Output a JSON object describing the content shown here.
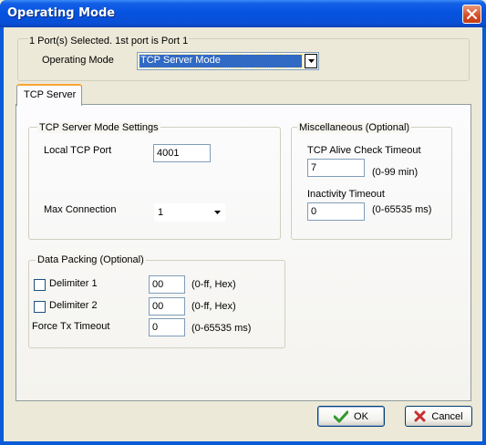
{
  "window": {
    "title": "Operating Mode"
  },
  "header": {
    "ports_info": "1 Port(s) Selected. 1st port is Port 1",
    "operating_mode_label": "Operating Mode",
    "operating_mode_value": "TCP Server Mode"
  },
  "tabs": [
    {
      "label": "TCP Server",
      "active": true
    }
  ],
  "tcp_server_settings": {
    "title": "TCP Server Mode Settings",
    "local_tcp_port_label": "Local TCP Port",
    "local_tcp_port_value": "4001",
    "max_connection_label": "Max Connection",
    "max_connection_value": "1"
  },
  "miscellaneous": {
    "title": "Miscellaneous (Optional)",
    "alive_check_label": "TCP Alive Check Timeout",
    "alive_check_value": "7",
    "alive_check_hint": "(0-99 min)",
    "inactivity_label": "Inactivity Timeout",
    "inactivity_value": "0",
    "inactivity_hint": "(0-65535 ms)"
  },
  "data_packing": {
    "title": "Data Packing (Optional)",
    "delimiter1_label": "Delimiter 1",
    "delimiter1_value": "00",
    "delimiter1_hint": "(0-ff, Hex)",
    "delimiter1_checked": false,
    "delimiter2_label": "Delimiter 2",
    "delimiter2_value": "00",
    "delimiter2_hint": "(0-ff, Hex)",
    "delimiter2_checked": false,
    "force_tx_label": "Force Tx Timeout",
    "force_tx_value": "0",
    "force_tx_hint": "(0-65535 ms)"
  },
  "buttons": {
    "ok_label": "OK",
    "cancel_label": "Cancel"
  },
  "colors": {
    "titlebar": "#0553e0",
    "dialog_bg": "#ece9d8",
    "ok_icon": "#2e9a2e",
    "cancel_icon": "#c62f2f",
    "tab_highlight": "#f8a535"
  }
}
